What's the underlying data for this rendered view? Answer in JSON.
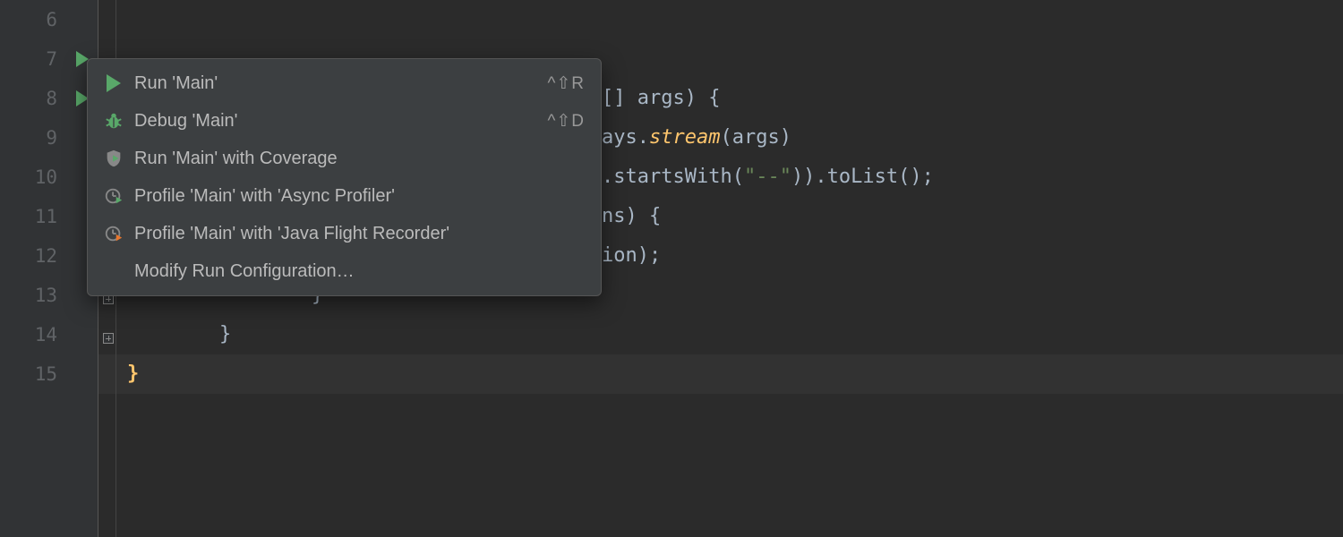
{
  "gutter": {
    "lines": [
      6,
      7,
      8,
      9,
      10,
      11,
      12,
      13,
      14,
      15
    ],
    "runnable_lines": [
      7,
      8
    ]
  },
  "code": {
    "line8_suffix": "[] args) {",
    "line9_prefix": "ays.",
    "line9_method": "stream",
    "line9_suffix": "(args)",
    "line10_method": ".startsWith",
    "line10_paren_open": "(",
    "line10_str": "\"--\"",
    "line10_suffix": ")).toList();",
    "line11_suffix": "ns) {",
    "line12_suffix": "ion);",
    "line13": "        }",
    "line14": "    }",
    "line15": "}"
  },
  "menu": {
    "items": [
      {
        "icon": "play",
        "label": "Run 'Main'",
        "shortcut": "^⇧R"
      },
      {
        "icon": "bug",
        "label": "Debug 'Main'",
        "shortcut": "^⇧D"
      },
      {
        "icon": "shield",
        "label": "Run 'Main' with Coverage",
        "shortcut": ""
      },
      {
        "icon": "clock-green",
        "label": "Profile 'Main' with 'Async Profiler'",
        "shortcut": ""
      },
      {
        "icon": "clock-orange",
        "label": "Profile 'Main' with 'Java Flight Recorder'",
        "shortcut": ""
      },
      {
        "icon": "none",
        "label": "Modify Run Configuration…",
        "shortcut": ""
      }
    ]
  }
}
